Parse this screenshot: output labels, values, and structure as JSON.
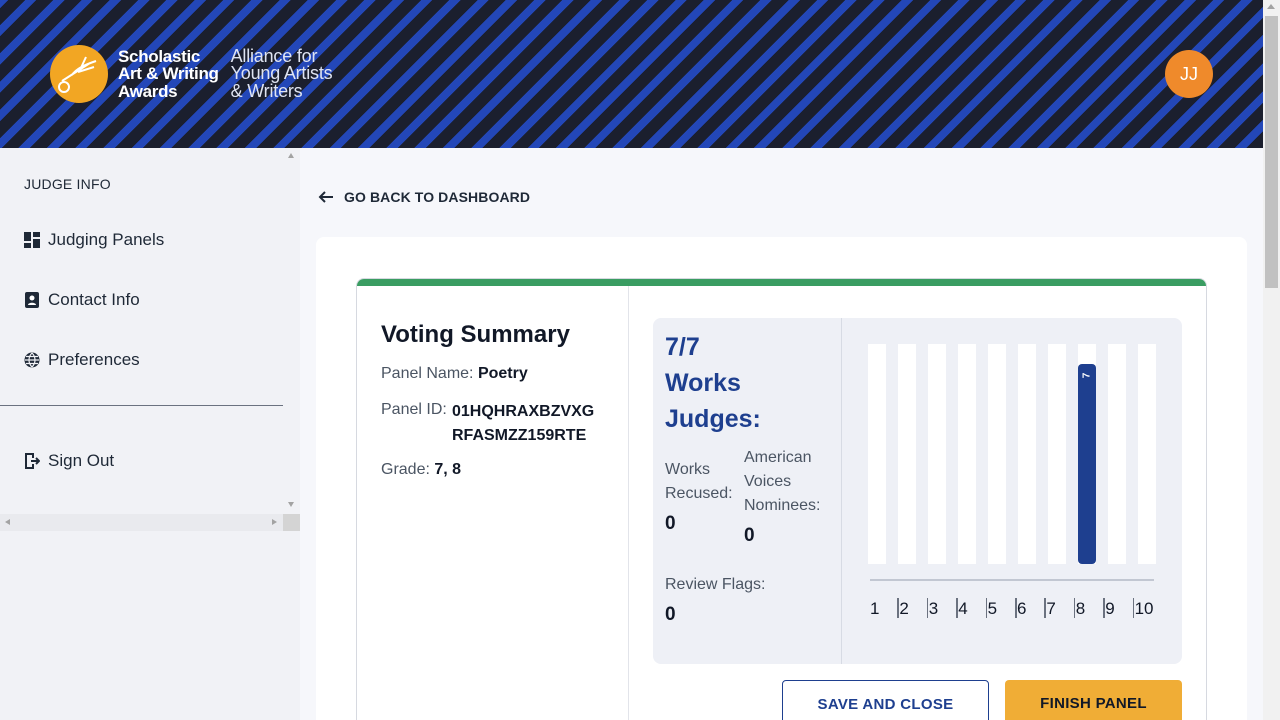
{
  "header": {
    "logo_title_lines": [
      "Scholastic",
      "Art & Writing",
      "Awards"
    ],
    "logo_sub_lines": [
      "Alliance for",
      "Young Artists",
      "& Writers"
    ],
    "avatar_initials": "JJ",
    "colors": {
      "stripe_dark": "#1b1f2e",
      "stripe_blue": "#2347b8",
      "logo": "#f2a623",
      "avatar": "#ef8a2b"
    }
  },
  "sidebar": {
    "heading": "JUDGE INFO",
    "items": [
      {
        "label": "Judging Panels",
        "icon": "dashboard-icon"
      },
      {
        "label": "Contact Info",
        "icon": "contact-card-icon"
      },
      {
        "label": "Preferences",
        "icon": "globe-icon"
      }
    ],
    "sign_out": {
      "label": "Sign Out",
      "icon": "exit-icon"
    }
  },
  "main": {
    "back_link": "GO BACK TO DASHBOARD",
    "summary": {
      "title": "Voting Summary",
      "panel_name_label": "Panel Name:",
      "panel_name": "Poetry",
      "panel_id_label": "Panel ID:",
      "panel_id_lines": [
        "01HQHRAXBZVXG",
        "RFASMZZ159RTE"
      ],
      "grade_label": "Grade:",
      "grade": "7, 8"
    },
    "stats": {
      "works_count": "7/7",
      "works_label": "Works",
      "judges_label": "Judges:",
      "works_recused_label_lines": [
        "Works",
        "Recused:"
      ],
      "works_recused": "0",
      "av_nominees_label_lines": [
        "American",
        "Voices",
        "Nominees:"
      ],
      "av_nominees": "0",
      "review_flags_label": "Review Flags:",
      "review_flags": "0"
    },
    "buttons": {
      "save": "SAVE AND CLOSE",
      "finish": "FINISH PANEL"
    },
    "accent_colors": {
      "progress": "#3a9d62",
      "primary": "#1e3f8f",
      "finish": "#f0ad36"
    }
  },
  "chart_data": {
    "type": "bar",
    "categories": [
      "1",
      "2",
      "3",
      "4",
      "5",
      "6",
      "7",
      "8",
      "9",
      "10"
    ],
    "values": [
      0,
      0,
      0,
      0,
      0,
      0,
      0,
      7,
      0,
      0
    ],
    "data_labels": [
      "",
      "",
      "",
      "",
      "",
      "",
      "",
      "7",
      "",
      ""
    ],
    "ylim": [
      0,
      7
    ],
    "grid": false
  }
}
